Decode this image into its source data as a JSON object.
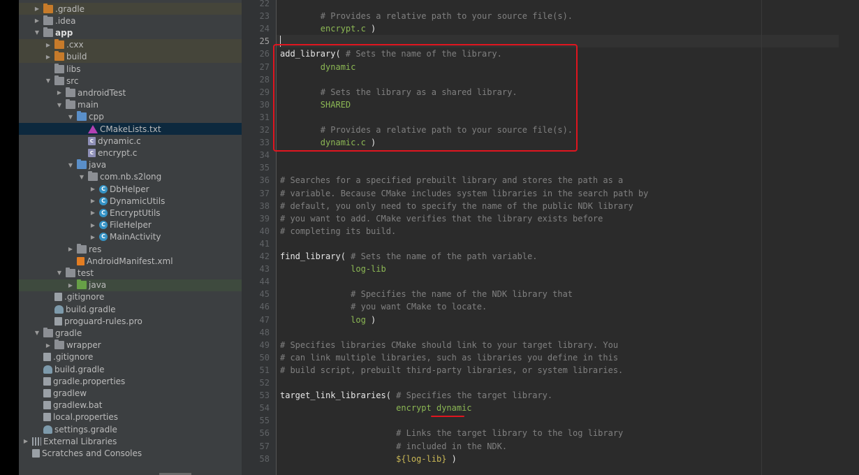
{
  "project_tree": [
    {
      "label": ".gradle",
      "icon": "folder-orange",
      "arrow": "right",
      "indent": 0,
      "hl": "olive"
    },
    {
      "label": ".idea",
      "icon": "folder",
      "arrow": "right",
      "indent": 0
    },
    {
      "label": "app",
      "icon": "folder-module",
      "arrow": "down",
      "indent": 0,
      "bold": true
    },
    {
      "label": ".cxx",
      "icon": "folder-orange",
      "arrow": "right",
      "indent": 1,
      "hl": "olive"
    },
    {
      "label": "build",
      "icon": "folder-orange",
      "arrow": "right",
      "indent": 1,
      "hl": "olive"
    },
    {
      "label": "libs",
      "icon": "folder",
      "arrow": "none",
      "indent": 1
    },
    {
      "label": "src",
      "icon": "folder",
      "arrow": "down",
      "indent": 1
    },
    {
      "label": "androidTest",
      "icon": "folder",
      "arrow": "right",
      "indent": 2
    },
    {
      "label": "main",
      "icon": "folder",
      "arrow": "down",
      "indent": 2
    },
    {
      "label": "cpp",
      "icon": "folder-blue",
      "arrow": "down",
      "indent": 3
    },
    {
      "label": "CMakeLists.txt",
      "icon": "cmake",
      "arrow": "none",
      "indent": 4,
      "hl": "blue"
    },
    {
      "label": "dynamic.c",
      "icon": "c-file",
      "arrow": "none",
      "indent": 4
    },
    {
      "label": "encrypt.c",
      "icon": "c-file",
      "arrow": "none",
      "indent": 4
    },
    {
      "label": "java",
      "icon": "folder-blue",
      "arrow": "down",
      "indent": 3
    },
    {
      "label": "com.nb.s2long",
      "icon": "folder",
      "arrow": "down",
      "indent": 4
    },
    {
      "label": "DbHelper",
      "icon": "class-c",
      "arrow": "right",
      "indent": 5
    },
    {
      "label": "DynamicUtils",
      "icon": "class-c",
      "arrow": "right",
      "indent": 5
    },
    {
      "label": "EncryptUtils",
      "icon": "class-c",
      "arrow": "right",
      "indent": 5
    },
    {
      "label": "FileHelper",
      "icon": "class-c",
      "arrow": "right",
      "indent": 5
    },
    {
      "label": "MainActivity",
      "icon": "class-c",
      "arrow": "right",
      "indent": 5
    },
    {
      "label": "res",
      "icon": "folder-res",
      "arrow": "right",
      "indent": 3
    },
    {
      "label": "AndroidManifest.xml",
      "icon": "xml",
      "arrow": "none",
      "indent": 3
    },
    {
      "label": "test",
      "icon": "folder",
      "arrow": "down",
      "indent": 2
    },
    {
      "label": "java",
      "icon": "folder-green",
      "arrow": "right",
      "indent": 3,
      "hl": "green"
    },
    {
      "label": ".gitignore",
      "icon": "file",
      "arrow": "none",
      "indent": 1
    },
    {
      "label": "build.gradle",
      "icon": "gradle",
      "arrow": "none",
      "indent": 1
    },
    {
      "label": "proguard-rules.pro",
      "icon": "file",
      "arrow": "none",
      "indent": 1
    },
    {
      "label": "gradle",
      "icon": "folder",
      "arrow": "down",
      "indent": 0
    },
    {
      "label": "wrapper",
      "icon": "folder",
      "arrow": "right",
      "indent": 1
    },
    {
      "label": ".gitignore",
      "icon": "file",
      "arrow": "none",
      "indent": 0
    },
    {
      "label": "build.gradle",
      "icon": "gradle",
      "arrow": "none",
      "indent": 0
    },
    {
      "label": "gradle.properties",
      "icon": "file",
      "arrow": "none",
      "indent": 0
    },
    {
      "label": "gradlew",
      "icon": "file",
      "arrow": "none",
      "indent": 0
    },
    {
      "label": "gradlew.bat",
      "icon": "file",
      "arrow": "none",
      "indent": 0
    },
    {
      "label": "local.properties",
      "icon": "file",
      "arrow": "none",
      "indent": 0
    },
    {
      "label": "settings.gradle",
      "icon": "gradle",
      "arrow": "none",
      "indent": 0
    },
    {
      "label": "External Libraries",
      "icon": "libs",
      "arrow": "right",
      "indent": -1
    },
    {
      "label": "Scratches and Consoles",
      "icon": "scratch",
      "arrow": "none",
      "indent": -1
    }
  ],
  "editor": {
    "current_line": 25,
    "lines": [
      {
        "n": 22,
        "parts": []
      },
      {
        "n": 23,
        "parts": [
          [
            "c",
            "        # Provides a relative path to your source file(s)."
          ]
        ]
      },
      {
        "n": 24,
        "parts": [
          [
            "s",
            "        encrypt.c"
          ],
          [
            "k",
            " )"
          ]
        ]
      },
      {
        "n": 25,
        "parts": []
      },
      {
        "n": 26,
        "parts": [
          [
            "k",
            "add_library( "
          ],
          [
            "c",
            "# Sets the name of the library."
          ]
        ]
      },
      {
        "n": 27,
        "parts": [
          [
            "s",
            "        dynamic"
          ]
        ]
      },
      {
        "n": 28,
        "parts": []
      },
      {
        "n": 29,
        "parts": [
          [
            "c",
            "        # Sets the library as a shared library."
          ]
        ]
      },
      {
        "n": 30,
        "parts": [
          [
            "s",
            "        SHARED"
          ]
        ]
      },
      {
        "n": 31,
        "parts": []
      },
      {
        "n": 32,
        "parts": [
          [
            "c",
            "        # Provides a relative path to your source file(s)."
          ]
        ]
      },
      {
        "n": 33,
        "parts": [
          [
            "s",
            "        dynamic.c"
          ],
          [
            "k",
            " )"
          ]
        ]
      },
      {
        "n": 34,
        "parts": []
      },
      {
        "n": 35,
        "parts": []
      },
      {
        "n": 36,
        "parts": [
          [
            "c",
            "# Searches for a specified prebuilt library and stores the path as a"
          ]
        ]
      },
      {
        "n": 37,
        "parts": [
          [
            "c",
            "# variable. Because CMake includes system libraries in the search path by"
          ]
        ]
      },
      {
        "n": 38,
        "parts": [
          [
            "c",
            "# default, you only need to specify the name of the public NDK library"
          ]
        ]
      },
      {
        "n": 39,
        "parts": [
          [
            "c",
            "# you want to add. CMake verifies that the library exists before"
          ]
        ]
      },
      {
        "n": 40,
        "parts": [
          [
            "c",
            "# completing its build."
          ]
        ]
      },
      {
        "n": 41,
        "parts": []
      },
      {
        "n": 42,
        "parts": [
          [
            "k",
            "find_library( "
          ],
          [
            "c",
            "# Sets the name of the path variable."
          ]
        ]
      },
      {
        "n": 43,
        "parts": [
          [
            "s",
            "              log-lib"
          ]
        ]
      },
      {
        "n": 44,
        "parts": []
      },
      {
        "n": 45,
        "parts": [
          [
            "c",
            "              # Specifies the name of the NDK library that"
          ]
        ]
      },
      {
        "n": 46,
        "parts": [
          [
            "c",
            "              # you want CMake to locate."
          ]
        ]
      },
      {
        "n": 47,
        "parts": [
          [
            "s",
            "              log"
          ],
          [
            "k",
            " )"
          ]
        ]
      },
      {
        "n": 48,
        "parts": []
      },
      {
        "n": 49,
        "parts": [
          [
            "c",
            "# Specifies libraries CMake should link to your target library. You"
          ]
        ]
      },
      {
        "n": 50,
        "parts": [
          [
            "c",
            "# can link multiple libraries, such as libraries you define in this"
          ]
        ]
      },
      {
        "n": 51,
        "parts": [
          [
            "c",
            "# build script, prebuilt third-party libraries, or system libraries."
          ]
        ]
      },
      {
        "n": 52,
        "parts": []
      },
      {
        "n": 53,
        "parts": [
          [
            "k",
            "target_link_libraries( "
          ],
          [
            "c",
            "# Specifies the target library."
          ]
        ]
      },
      {
        "n": 54,
        "parts": [
          [
            "s",
            "                       encrypt dynamic"
          ]
        ]
      },
      {
        "n": 55,
        "parts": []
      },
      {
        "n": 56,
        "parts": [
          [
            "c",
            "                       # Links the target library to the log library"
          ]
        ]
      },
      {
        "n": 57,
        "parts": [
          [
            "c",
            "                       # included in the NDK."
          ]
        ]
      },
      {
        "n": 58,
        "parts": [
          [
            "v",
            "                       ${log-lib}"
          ],
          [
            "k",
            " )"
          ]
        ]
      }
    ]
  }
}
